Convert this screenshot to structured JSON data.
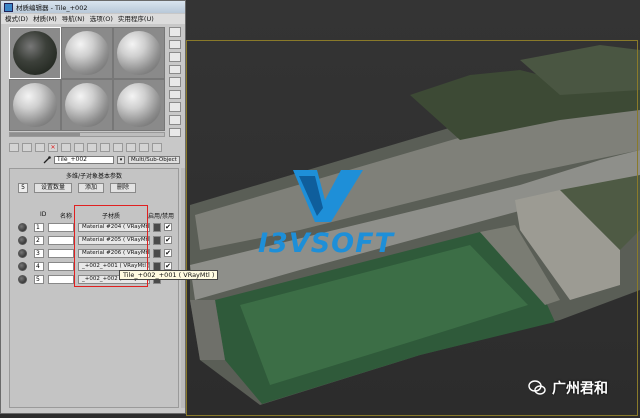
{
  "window": {
    "title": "材质编辑器 - Tile_+002",
    "menu": [
      "模式(D)",
      "材质(M)",
      "导航(N)",
      "选项(O)",
      "实用程序(U)"
    ]
  },
  "material": {
    "name": "Tile_+002",
    "type": "Multi/Sub-Object"
  },
  "panel": {
    "title": "多维/子对象基本参数",
    "count": "5",
    "buttons": {
      "set_count": "设置数量",
      "add": "添加",
      "delete": "删除"
    },
    "headers": {
      "id": "ID",
      "name": "名称",
      "sub": "子材质",
      "toggle": "启用/禁用"
    },
    "rows": [
      {
        "id": "1",
        "sub": "Material #204 ( VRayMtl )",
        "checked": "✔"
      },
      {
        "id": "2",
        "sub": "Material #205 ( VRayMtl )",
        "checked": "✔"
      },
      {
        "id": "3",
        "sub": "Material #206 ( VRayMtl )",
        "checked": "✔"
      },
      {
        "id": "4",
        "sub": "_+002_+001 ( VRayMtl )",
        "checked": "✔"
      },
      {
        "id": "5",
        "sub": "_+002_+002 ( VRayMtl )",
        "checked": ""
      }
    ],
    "tooltip": "Tile_+002_+001 ( VRayMtl )"
  },
  "viewport": {
    "logo_text": "I3VSOFT",
    "watermark": "广州君和"
  },
  "colors": {
    "logo_blue": "#1e8fd8",
    "highlight_red": "#e02020",
    "viewport_border": "#8a7a2a"
  }
}
